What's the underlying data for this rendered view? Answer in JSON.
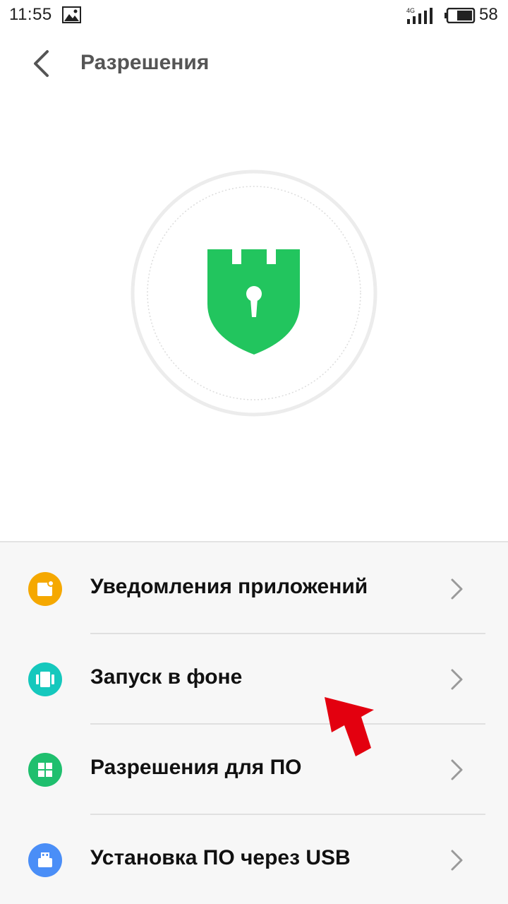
{
  "status_bar": {
    "time": "11:55",
    "network": "4G",
    "battery_level": "58"
  },
  "header": {
    "title": "Разрешения",
    "back_icon": "chevron-left-icon"
  },
  "hero": {
    "icon": "shield-lock-icon",
    "shield_color": "#22c55e"
  },
  "items": [
    {
      "label": "Уведомления приложений",
      "icon": "notification-icon",
      "color": "#f5a800"
    },
    {
      "label": "Запуск в фоне",
      "icon": "background-run-icon",
      "color": "#15c8bd"
    },
    {
      "label": "Разрешения для ПО",
      "icon": "app-grid-icon",
      "color": "#1fbf6e"
    },
    {
      "label": "Установка ПО через USB",
      "icon": "usb-icon",
      "color": "#4a8ef7"
    }
  ],
  "annotation": {
    "arrow_color": "#e3000f"
  }
}
